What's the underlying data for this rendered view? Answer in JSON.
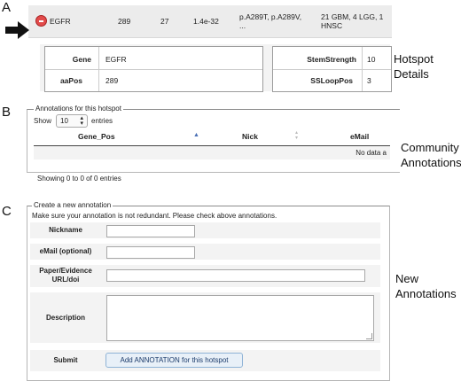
{
  "panels": {
    "a": {
      "letter": "A",
      "side_label_1": "Hotspot",
      "side_label_2": "Details",
      "row": {
        "gene": "EGFR",
        "position": "289",
        "count": "27",
        "pvalue": "1.4e-32",
        "mutations_1": "p.A289T, p.A289V,",
        "mutations_2": "...",
        "tumor_types_1": "21 GBM, 4 LGG, 1",
        "tumor_types_2": "HNSC"
      },
      "details": {
        "left": [
          {
            "key": "Gene",
            "value": "EGFR"
          },
          {
            "key": "aaPos",
            "value": "289"
          }
        ],
        "right": [
          {
            "key": "StemStrength",
            "value": "10"
          },
          {
            "key": "SSLoopPos",
            "value": "3"
          }
        ]
      }
    },
    "b": {
      "letter": "B",
      "side_label_1": "Community",
      "side_label_2": "Annotations",
      "legend": "Annotations for this hotspot",
      "show_label": "Show",
      "entries_value": "10",
      "entries_label": "entries",
      "columns": [
        "Gene_Pos",
        "Nick",
        "eMail"
      ],
      "empty_text": "No data a",
      "footer": "Showing 0 to 0 of 0 entries"
    },
    "c": {
      "letter": "C",
      "side_label_1": "New",
      "side_label_2": "Annotations",
      "legend": "Create a new annotation",
      "notice": "Make sure your annotation is not redundant. Please check above annotations.",
      "fields": {
        "nickname": "Nickname",
        "email": "eMail (optional)",
        "paper_1": "Paper/Evidence",
        "paper_2": "URL/doi",
        "description": "Description",
        "submit": "Submit"
      },
      "button": "Add ANNOTATION for this hotspot"
    }
  }
}
